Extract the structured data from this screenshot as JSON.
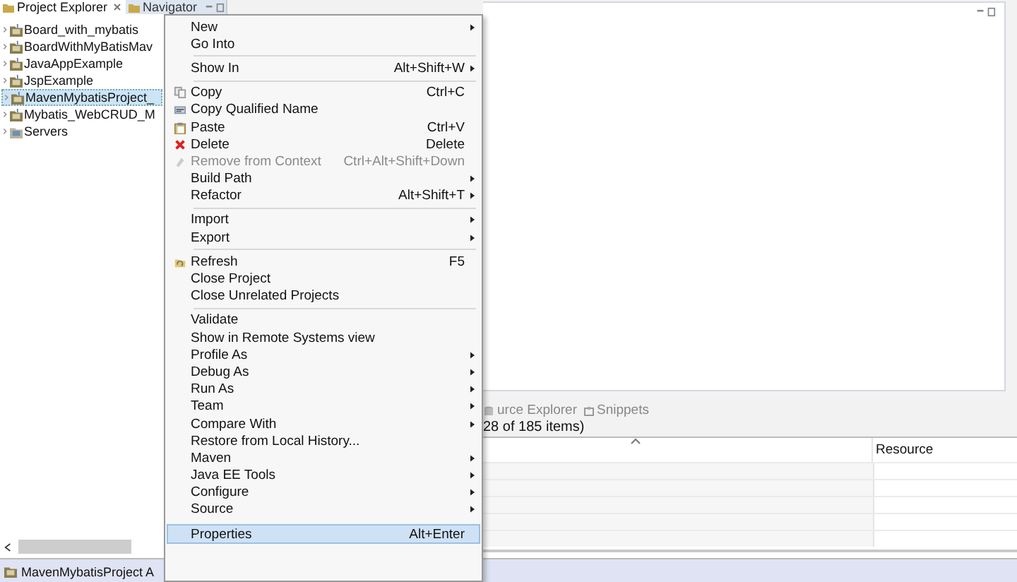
{
  "explorer": {
    "tabs": [
      {
        "label": "Project Explorer",
        "selected": true,
        "closable": true
      },
      {
        "label": "Navigator",
        "selected": false,
        "closable": false
      }
    ],
    "tree": [
      {
        "label": "Board_with_mybatis",
        "kind": "project",
        "expanded": false,
        "selected": false
      },
      {
        "label": "BoardWithMyBatisMav",
        "kind": "project",
        "expanded": false,
        "selected": false
      },
      {
        "label": "JavaAppExample",
        "kind": "project",
        "expanded": false,
        "selected": false
      },
      {
        "label": "JspExample",
        "kind": "project",
        "expanded": false,
        "selected": false
      },
      {
        "label": "MavenMybatisProject_",
        "kind": "project",
        "expanded": false,
        "selected": true
      },
      {
        "label": "Mybatis_WebCRUD_M",
        "kind": "project",
        "expanded": false,
        "selected": false
      },
      {
        "label": "Servers",
        "kind": "servers",
        "expanded": false,
        "selected": false
      }
    ]
  },
  "bottom_panel": {
    "tabs": [
      {
        "label": "urce Explorer",
        "kind": "database"
      },
      {
        "label": "Snippets",
        "kind": "snippets"
      }
    ],
    "summary": "28 of 185 items)",
    "table": {
      "columns": [
        {
          "sorted": true
        },
        {
          "label": "Resource",
          "sorted": false
        }
      ]
    }
  },
  "status_bar": {
    "text": "MavenMybatisProject A"
  },
  "context_menu": {
    "items": [
      {
        "label": "New",
        "kind": "plain",
        "submenu": true,
        "disabled": false,
        "selected": false,
        "separator_above": false
      },
      {
        "label": "Go Into",
        "kind": "plain",
        "submenu": false,
        "disabled": false,
        "selected": false,
        "separator_above": false
      },
      {
        "label": "Show In",
        "shortcut": "Alt+Shift+W",
        "kind": "plain",
        "submenu": true,
        "disabled": false,
        "selected": false,
        "separator_above": true
      },
      {
        "label": "Copy",
        "shortcut": "Ctrl+C",
        "kind": "copy",
        "submenu": false,
        "disabled": false,
        "selected": false,
        "separator_above": true
      },
      {
        "label": "Copy Qualified Name",
        "kind": "copy-name",
        "submenu": false,
        "disabled": false,
        "selected": false,
        "separator_above": false
      },
      {
        "label": "Paste",
        "shortcut": "Ctrl+V",
        "kind": "paste",
        "submenu": false,
        "disabled": false,
        "selected": false,
        "separator_above": false
      },
      {
        "label": "Delete",
        "shortcut": "Delete",
        "kind": "delete",
        "submenu": false,
        "disabled": false,
        "selected": false,
        "separator_above": false
      },
      {
        "label": "Remove from Context",
        "shortcut": "Ctrl+Alt+Shift+Down",
        "kind": "remove",
        "submenu": false,
        "disabled": true,
        "selected": false,
        "separator_above": false
      },
      {
        "label": "Build Path",
        "kind": "plain",
        "submenu": true,
        "disabled": false,
        "selected": false,
        "separator_above": false
      },
      {
        "label": "Refactor",
        "shortcut": "Alt+Shift+T",
        "kind": "plain",
        "submenu": true,
        "disabled": false,
        "selected": false,
        "separator_above": false
      },
      {
        "label": "Import",
        "kind": "plain",
        "submenu": true,
        "disabled": false,
        "selected": false,
        "separator_above": true
      },
      {
        "label": "Export",
        "kind": "plain",
        "submenu": true,
        "disabled": false,
        "selected": false,
        "separator_above": false
      },
      {
        "label": "Refresh",
        "shortcut": "F5",
        "kind": "refresh",
        "submenu": false,
        "disabled": false,
        "selected": false,
        "separator_above": true
      },
      {
        "label": "Close Project",
        "kind": "plain",
        "submenu": false,
        "disabled": false,
        "selected": false,
        "separator_above": false
      },
      {
        "label": "Close Unrelated Projects",
        "kind": "plain",
        "submenu": false,
        "disabled": false,
        "selected": false,
        "separator_above": false
      },
      {
        "label": "Validate",
        "kind": "plain",
        "submenu": false,
        "disabled": false,
        "selected": false,
        "separator_above": true
      },
      {
        "label": "Show in Remote Systems view",
        "kind": "plain",
        "submenu": false,
        "disabled": false,
        "selected": false,
        "separator_above": false
      },
      {
        "label": "Profile As",
        "kind": "plain",
        "submenu": true,
        "disabled": false,
        "selected": false,
        "separator_above": false
      },
      {
        "label": "Debug As",
        "kind": "plain",
        "submenu": true,
        "disabled": false,
        "selected": false,
        "separator_above": false
      },
      {
        "label": "Run As",
        "kind": "plain",
        "submenu": true,
        "disabled": false,
        "selected": false,
        "separator_above": false
      },
      {
        "label": "Team",
        "kind": "plain",
        "submenu": true,
        "disabled": false,
        "selected": false,
        "separator_above": false
      },
      {
        "label": "Compare With",
        "kind": "plain",
        "submenu": true,
        "disabled": false,
        "selected": false,
        "separator_above": false
      },
      {
        "label": "Restore from Local History...",
        "kind": "plain",
        "submenu": false,
        "disabled": false,
        "selected": false,
        "separator_above": false
      },
      {
        "label": "Maven",
        "kind": "plain",
        "submenu": true,
        "disabled": false,
        "selected": false,
        "separator_above": false
      },
      {
        "label": "Java EE Tools",
        "kind": "plain",
        "submenu": true,
        "disabled": false,
        "selected": false,
        "separator_above": false
      },
      {
        "label": "Configure",
        "kind": "plain",
        "submenu": true,
        "disabled": false,
        "selected": false,
        "separator_above": false
      },
      {
        "label": "Source",
        "kind": "plain",
        "submenu": true,
        "disabled": false,
        "selected": false,
        "separator_above": false
      },
      {
        "label": "Properties",
        "shortcut": "Alt+Enter",
        "kind": "plain",
        "submenu": false,
        "disabled": false,
        "selected": true,
        "separator_above": true
      }
    ]
  }
}
